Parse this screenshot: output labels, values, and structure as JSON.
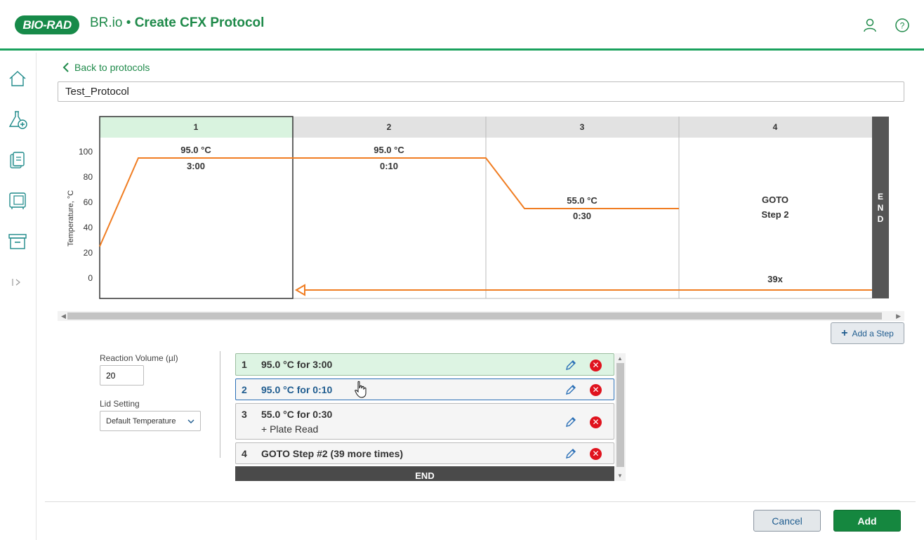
{
  "header": {
    "logo_text": "BIO-RAD",
    "app_name": "BR.io",
    "separator": "•",
    "page_title": "Create CFX Protocol"
  },
  "nav": {
    "back_label": "Back to protocols"
  },
  "protocol": {
    "name": "Test_Protocol"
  },
  "chart": {
    "y_axis_label": "Temperature, °C",
    "y_ticks": [
      "100",
      "80",
      "60",
      "40",
      "20",
      "0"
    ],
    "columns": [
      {
        "header": "1",
        "temp": "95.0 °C",
        "time": "3:00"
      },
      {
        "header": "2",
        "temp": "95.0 °C",
        "time": "0:10"
      },
      {
        "header": "3",
        "temp": "55.0 °C",
        "time": "0:30"
      },
      {
        "header": "4",
        "line1": "GOTO",
        "line2": "Step 2",
        "repeat": "39x"
      }
    ],
    "end_letters": [
      "E",
      "N",
      "D"
    ],
    "colors": {
      "profile": "#f07d22",
      "selected_header": "#d9f3df",
      "end_bar": "#555555"
    }
  },
  "chart_data": {
    "type": "line",
    "y_axis_label": "Temperature, °C",
    "ylim": [
      0,
      100
    ],
    "steps": [
      {
        "step": 1,
        "temperature_c": 95.0,
        "time": "3:00"
      },
      {
        "step": 2,
        "temperature_c": 95.0,
        "time": "0:10"
      },
      {
        "step": 3,
        "temperature_c": 55.0,
        "time": "0:30"
      },
      {
        "step": 4,
        "goto_step": 2,
        "repeat": 39
      }
    ]
  },
  "toolbar": {
    "add_step_label": "Add a Step"
  },
  "form": {
    "reaction_volume_label": "Reaction Volume (µl)",
    "reaction_volume_value": "20",
    "lid_setting_label": "Lid Setting",
    "lid_setting_value": "Default Temperature"
  },
  "steps": [
    {
      "num": "1",
      "text": "95.0 °C for 3:00"
    },
    {
      "num": "2",
      "text": "95.0 °C for 0:10"
    },
    {
      "num": "3",
      "text": "55.0 °C for 0:30",
      "sub": "+ Plate Read"
    },
    {
      "num": "4",
      "text": "GOTO Step #2 (39 more times)"
    }
  ],
  "steps_end_label": "END",
  "footer": {
    "cancel_label": "Cancel",
    "add_label": "Add"
  }
}
